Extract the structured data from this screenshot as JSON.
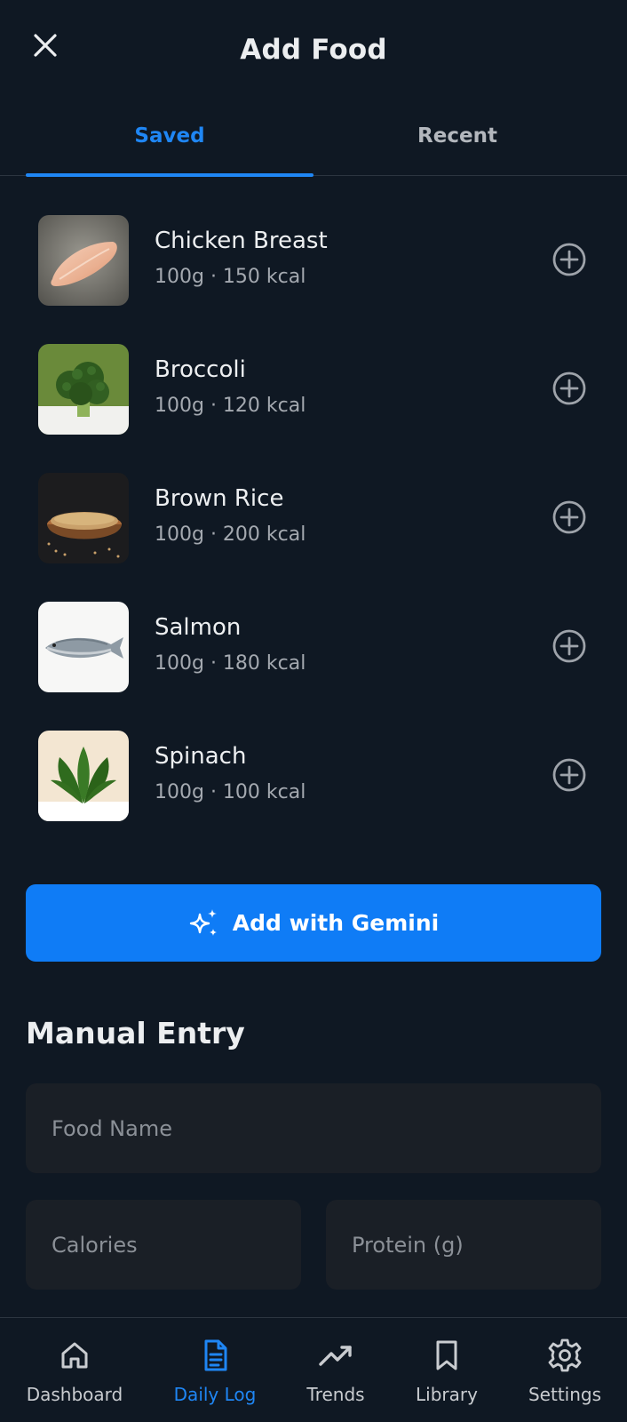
{
  "header": {
    "title": "Add Food",
    "close_icon": "close-icon"
  },
  "tabs": [
    {
      "label": "Saved",
      "active": true
    },
    {
      "label": "Recent",
      "active": false
    }
  ],
  "foods": [
    {
      "name": "Chicken Breast",
      "meta": "100g · 150 kcal",
      "icon": "chicken-breast-image"
    },
    {
      "name": "Broccoli",
      "meta": "100g · 120 kcal",
      "icon": "broccoli-image"
    },
    {
      "name": "Brown Rice",
      "meta": "100g · 200 kcal",
      "icon": "brown-rice-image"
    },
    {
      "name": "Salmon",
      "meta": "100g · 180 kcal",
      "icon": "salmon-image"
    },
    {
      "name": "Spinach",
      "meta": "100g · 100 kcal",
      "icon": "spinach-image"
    }
  ],
  "gemini_button": {
    "label": "Add with Gemini",
    "icon": "sparkle-icon"
  },
  "manual_entry": {
    "title": "Manual Entry",
    "food_name_placeholder": "Food Name",
    "calories_placeholder": "Calories",
    "protein_placeholder": "Protein (g)"
  },
  "bottom_nav": [
    {
      "label": "Dashboard",
      "icon": "home-icon",
      "active": false
    },
    {
      "label": "Daily Log",
      "icon": "document-icon",
      "active": true
    },
    {
      "label": "Trends",
      "icon": "trending-up-icon",
      "active": false
    },
    {
      "label": "Library",
      "icon": "bookmark-icon",
      "active": false
    },
    {
      "label": "Settings",
      "icon": "gear-icon",
      "active": false
    }
  ],
  "colors": {
    "background": "#0f1823",
    "accent": "#1f86f4",
    "button": "#0f7cf6",
    "field": "#1a1f26"
  }
}
